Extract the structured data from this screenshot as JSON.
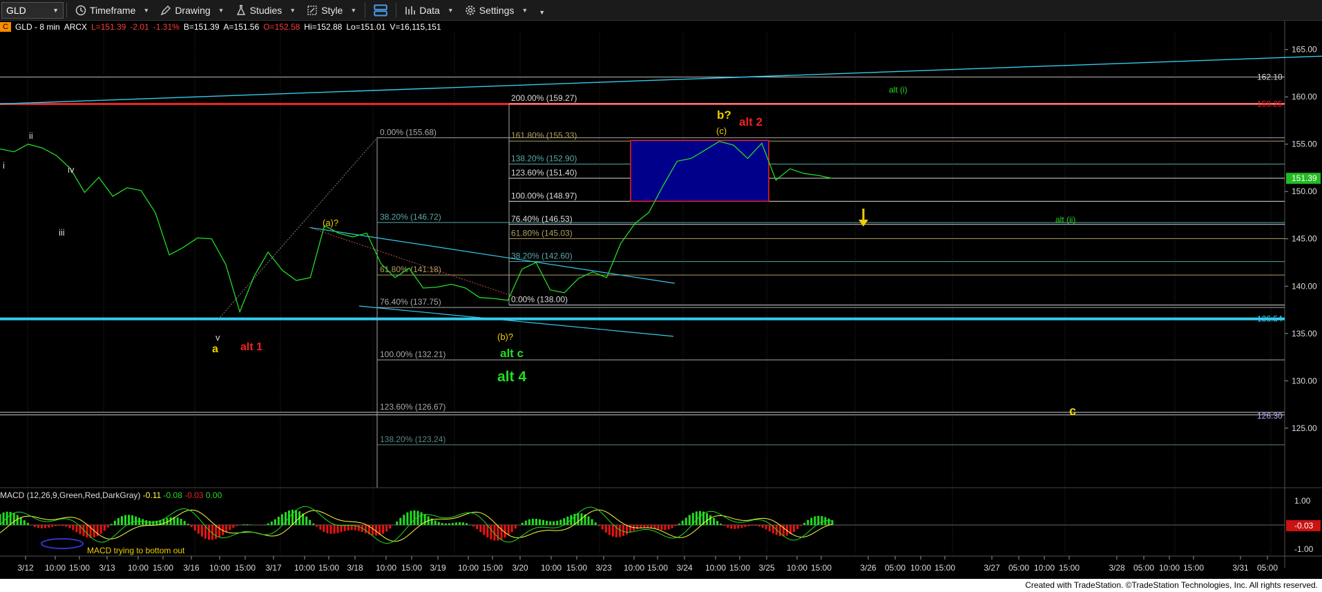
{
  "toolbar": {
    "symbol": "GLD",
    "items": [
      {
        "label": "Timeframe",
        "icon": "clock-icon"
      },
      {
        "label": "Drawing",
        "icon": "drawing-icon"
      },
      {
        "label": "Studies",
        "icon": "studies-icon"
      },
      {
        "label": "Style",
        "icon": "style-icon"
      },
      {
        "label": "",
        "icon": "layout-icon"
      },
      {
        "label": "Data",
        "icon": "data-icon"
      },
      {
        "label": "Settings",
        "icon": "gear-icon"
      }
    ]
  },
  "info": {
    "tag": "C",
    "symbol_desc": "GLD - 8 min",
    "exchange": "ARCX",
    "last": "L=151.39",
    "chg": "-2.01",
    "chg_pct": "-1.31%",
    "bid": "B=151.39",
    "ask": "A=151.56",
    "open": "O=152.58",
    "high": "Hi=152.88",
    "low": "Lo=151.01",
    "volume": "V=16,115,151"
  },
  "colors": {
    "background": "#000000",
    "price": "#22dd22",
    "macd_line": "#22dd22",
    "signal_line": "#ffff44",
    "hist_pos": "#22dd22",
    "hist_neg": "#ee1111",
    "support": "#33ccee",
    "resistance": "#ee2222",
    "box_fill": "#00008b"
  },
  "chart_data": {
    "type": "line",
    "ylim": [
      119,
      166
    ],
    "price_axis_ticks": [
      "165.00",
      "160.00",
      "155.00",
      "150.00",
      "145.00",
      "140.00",
      "135.00",
      "130.00",
      "125.00"
    ],
    "price_axis_values": [
      165,
      160,
      155,
      150,
      145,
      140,
      135,
      130,
      125
    ],
    "last_price": {
      "label": "151.39",
      "value": 151.39
    },
    "price_labels": [
      {
        "label": "162.10",
        "value": 162.1,
        "color": "#dddddd"
      },
      {
        "label": "159.25",
        "value": 159.25,
        "color": "#ee2222"
      },
      {
        "label": "136.54",
        "value": 136.54,
        "color": "#33ccee"
      },
      {
        "label": "126.30",
        "value": 126.3,
        "color": "#aaaaff"
      }
    ],
    "x_axis_ticks": [
      "3/12",
      "10:00",
      "15:00",
      "3/13",
      "10:00",
      "15:00",
      "3/16",
      "10:00",
      "15:00",
      "3/17",
      "10:00",
      "15:00",
      "3/18",
      "10:00",
      "15:00",
      "3/19",
      "10:00",
      "15:00",
      "3/20",
      "10:00",
      "15:00",
      "3/23",
      "10:00",
      "15:00",
      "3/24",
      "10:00",
      "15:00",
      "3/25",
      "10:00",
      "15:00",
      "3/26",
      "05:00",
      "10:00",
      "15:00",
      "3/27",
      "05:00",
      "10:00",
      "15:00",
      "3/28",
      "05:00",
      "10:00",
      "15:00",
      "3/31",
      "05:00"
    ],
    "series": [
      {
        "name": "GLD",
        "values": [
          154.5,
          154.2,
          155,
          154.6,
          153.8,
          152.4,
          149.9,
          151.5,
          149.5,
          150.4,
          150.1,
          147.8,
          143.3,
          144.1,
          145.1,
          145,
          142.3,
          137.3,
          141,
          143.6,
          141.7,
          140.6,
          140.9,
          146.4,
          145.6,
          145.2,
          145.6,
          142.4,
          140.9,
          141.9,
          139.8,
          139.9,
          140.2,
          139.8,
          138.8,
          138.7,
          138.5,
          141.8,
          142.5,
          139.6,
          139.3,
          140.8,
          141.5,
          140.9,
          144.5,
          146.6,
          147.8,
          150.6,
          153.2,
          153.5,
          154.4,
          155.3,
          154.9,
          153.5,
          155.1,
          151.2,
          152.4,
          151.9,
          151.7,
          151.39
        ]
      }
    ],
    "macd": {
      "label": "MACD (12,26,9,Green,Red,DarkGray)",
      "v1": "-0.11",
      "v2": "-0.08",
      "v3": "-0.03",
      "v4": "0.00",
      "ticks": [
        "1.00",
        "-1.00"
      ],
      "tick_values": [
        1,
        -1
      ],
      "current_label": "-0.03",
      "current": -0.03
    },
    "fib_left": [
      {
        "label": "0.00% (155.68)",
        "value": 155.68
      },
      {
        "label": "38.20% (146.72)",
        "value": 146.72
      },
      {
        "label": "61.80% (141.18)",
        "value": 141.18
      },
      {
        "label": "76.40% (137.75)",
        "value": 137.75
      },
      {
        "label": "100.00% (132.21)",
        "value": 132.21
      },
      {
        "label": "123.60% (126.67)",
        "value": 126.67
      },
      {
        "label": "138.20% (123.24)",
        "value": 123.24
      }
    ],
    "fib_right": [
      {
        "label": "200.00% (159.27)",
        "value": 159.27
      },
      {
        "label": "161.80% (155.33)",
        "value": 155.33
      },
      {
        "label": "138.20% (152.90)",
        "value": 152.9
      },
      {
        "label": "123.60% (151.40)",
        "value": 151.4
      },
      {
        "label": "100.00% (148.97)",
        "value": 148.97
      },
      {
        "label": "76.40% (146.53)",
        "value": 146.53
      },
      {
        "label": "61.80% (145.03)",
        "value": 145.03
      },
      {
        "label": "38.20% (142.60)",
        "value": 142.6
      },
      {
        "label": "0.00% (138.00)",
        "value": 138.0
      }
    ],
    "annotations": [
      {
        "text": "i",
        "color": "#dddddd"
      },
      {
        "text": "ii",
        "color": "#dddddd"
      },
      {
        "text": "iii",
        "color": "#dddddd"
      },
      {
        "text": "iv",
        "color": "#dddddd"
      },
      {
        "text": "v",
        "color": "#dddddd"
      },
      {
        "text": "a",
        "color": "#f0d000"
      },
      {
        "text": "alt 1",
        "color": "#ee2222"
      },
      {
        "text": "(a)?",
        "color": "#f0d000"
      },
      {
        "text": "(b)?",
        "color": "#f0d000"
      },
      {
        "text": "alt c",
        "color": "#22dd22"
      },
      {
        "text": "alt 4",
        "color": "#22dd22"
      },
      {
        "text": "b?",
        "color": "#f0d000"
      },
      {
        "text": "(c)",
        "color": "#f0d000"
      },
      {
        "text": "alt 2",
        "color": "#ee2222"
      },
      {
        "text": "alt (i)",
        "color": "#22dd22"
      },
      {
        "text": "alt (ii)",
        "color": "#22dd22"
      },
      {
        "text": "c",
        "color": "#f0d000"
      },
      {
        "text": "MACD trying to bottom out",
        "color": "#f0d000"
      }
    ]
  },
  "footer": "Created with TradeStation. ©TradeStation Technologies, Inc. All rights reserved."
}
